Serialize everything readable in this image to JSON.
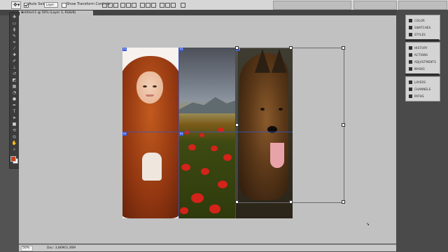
{
  "options_bar": {
    "auto_select_label": "Auto Select:",
    "auto_select_value": "Layer",
    "show_transform_label": "Show Transform Controls"
  },
  "document": {
    "tab_title": "Untitled-1 @ 50% (Layer 3, RGB/8)",
    "close_glyph": "×"
  },
  "tools": [
    {
      "name": "move-tool-icon",
      "glyph": "✥"
    },
    {
      "name": "marquee-tool-icon",
      "glyph": "▭"
    },
    {
      "name": "lasso-tool-icon",
      "glyph": "ϕ"
    },
    {
      "name": "quick-select-tool-icon",
      "glyph": "✎"
    },
    {
      "name": "crop-tool-icon",
      "glyph": "⌗"
    },
    {
      "name": "eyedropper-tool-icon",
      "glyph": "⁄"
    },
    {
      "name": "healing-brush-tool-icon",
      "glyph": "✚"
    },
    {
      "name": "brush-tool-icon",
      "glyph": "✐"
    },
    {
      "name": "clone-stamp-tool-icon",
      "glyph": "⊥"
    },
    {
      "name": "history-brush-tool-icon",
      "glyph": "↺"
    },
    {
      "name": "eraser-tool-icon",
      "glyph": "◩"
    },
    {
      "name": "gradient-tool-icon",
      "glyph": "▦"
    },
    {
      "name": "blur-tool-icon",
      "glyph": "◔"
    },
    {
      "name": "dodge-tool-icon",
      "glyph": "●"
    },
    {
      "name": "pen-tool-icon",
      "glyph": "✒"
    },
    {
      "name": "type-tool-icon",
      "glyph": "T"
    },
    {
      "name": "path-select-tool-icon",
      "glyph": "➤"
    },
    {
      "name": "shape-tool-icon",
      "glyph": "■"
    },
    {
      "name": "3d-rotate-tool-icon",
      "glyph": "⟲"
    },
    {
      "name": "3d-orbit-tool-icon",
      "glyph": "◎"
    },
    {
      "name": "hand-tool-icon",
      "glyph": "✋"
    },
    {
      "name": "zoom-tool-icon",
      "glyph": "⌕"
    }
  ],
  "colors": {
    "foreground": "#c8421c",
    "background": "#ffffff",
    "slice_badge": "#3a5be0"
  },
  "slices": [
    "01",
    "02",
    "03",
    "04",
    "05"
  ],
  "status": {
    "zoom": "50%",
    "doc_info": "Doc: 3,86M/3,36M"
  },
  "panels": {
    "group1": [
      {
        "label": "COLOR",
        "icon": "color-panel-icon"
      },
      {
        "label": "SWATCHES",
        "icon": "swatches-panel-icon"
      },
      {
        "label": "STYLES",
        "icon": "styles-panel-icon"
      }
    ],
    "group2": [
      {
        "label": "HISTORY",
        "icon": "history-panel-icon"
      },
      {
        "label": "ACTIONS",
        "icon": "actions-panel-icon"
      },
      {
        "label": "ADJUSTMENTS",
        "icon": "adjustments-panel-icon"
      },
      {
        "label": "MASKS",
        "icon": "masks-panel-icon"
      }
    ],
    "group3": [
      {
        "label": "LAYERS",
        "icon": "layers-panel-icon"
      },
      {
        "label": "CHANNELS",
        "icon": "channels-panel-icon"
      },
      {
        "label": "PATHS",
        "icon": "paths-panel-icon"
      }
    ]
  }
}
